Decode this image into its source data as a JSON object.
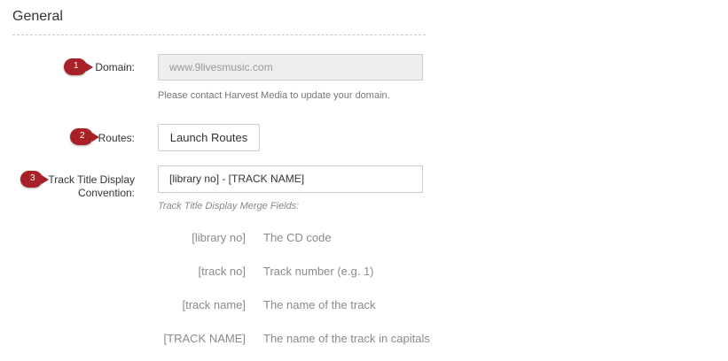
{
  "section": {
    "title": "General"
  },
  "domain": {
    "marker": "1",
    "label": "Domain:",
    "value": "www.9livesmusic.com",
    "help": "Please contact Harvest Media to update your domain."
  },
  "routes": {
    "marker": "2",
    "label": "Routes:",
    "button_label": "Launch Routes"
  },
  "track_title": {
    "marker": "3",
    "label_line1": "Track Title Display",
    "label_line2": "Convention:",
    "value": "[library no] - [TRACK NAME]",
    "merge_fields_heading": "Track Title Display Merge Fields:",
    "merge_fields": [
      {
        "key": "[library no]",
        "description": "The CD code"
      },
      {
        "key": "[track no]",
        "description": "Track number (e.g. 1)"
      },
      {
        "key": "[track name]",
        "description": "The name of the track"
      },
      {
        "key": "[TRACK NAME]",
        "description": "The name of the track in capitals"
      }
    ]
  },
  "colors": {
    "marker": "#a82129",
    "input_disabled_bg": "#eeeeee"
  }
}
